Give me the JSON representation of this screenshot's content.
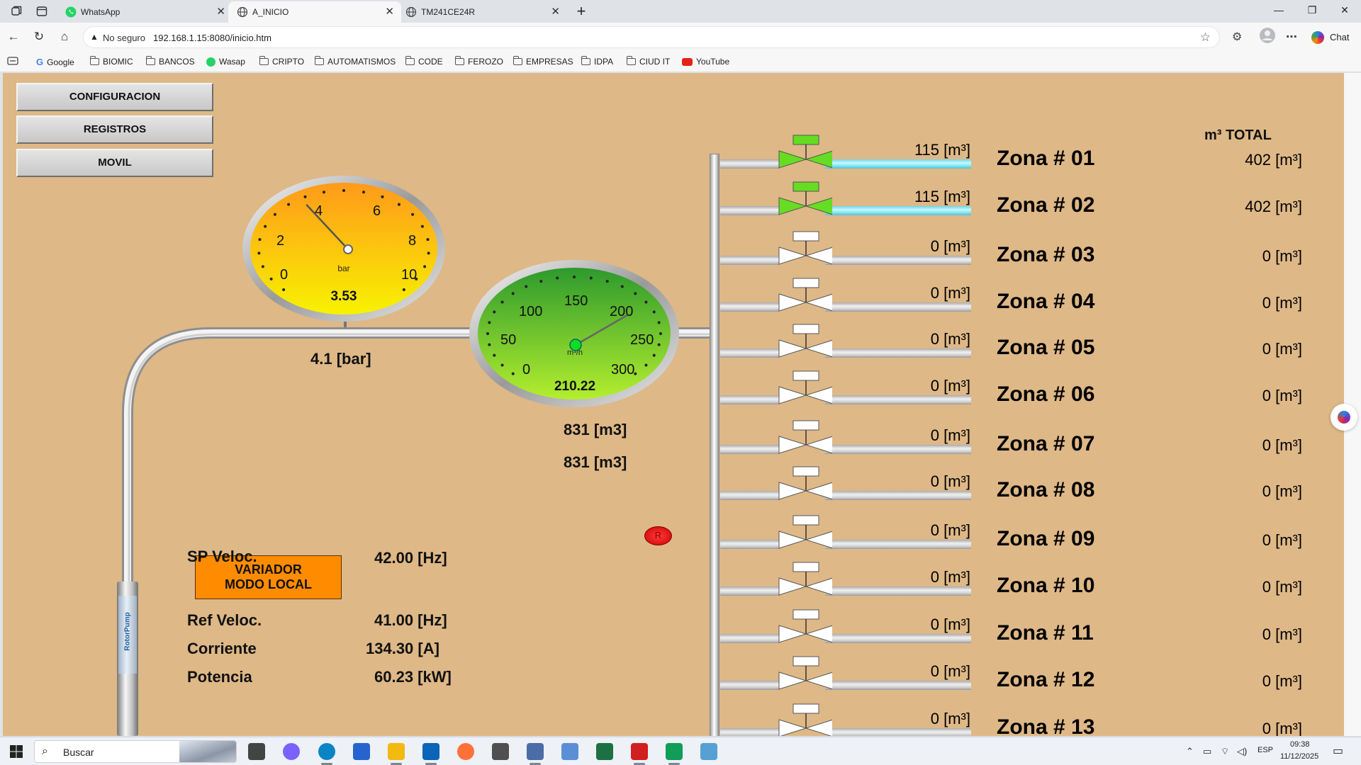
{
  "browser": {
    "tabs": [
      {
        "title": "WhatsApp",
        "active": false
      },
      {
        "title": "A_INICIO",
        "active": true
      },
      {
        "title": "TM241CE24R",
        "active": false
      }
    ],
    "security_label": "No seguro",
    "url": "192.168.1.15:8080/inicio.htm",
    "chat_label": "Chat",
    "bookmarks": [
      "Google",
      "BIOMIC",
      "BANCOS",
      "Wasap",
      "CRIPTO",
      "AUTOMATISMOS",
      "CODE",
      "FEROZO",
      "EMPRESAS",
      "IDPA",
      "CIUD IT",
      "YouTube"
    ]
  },
  "scada": {
    "menu": [
      "CONFIGURACION",
      "REGISTROS",
      "MOVIL"
    ],
    "pressure_gauge": {
      "unit": "bar",
      "value": "3.53",
      "numeric_value": 3.53,
      "min": 0,
      "max": 10,
      "ticks": [
        "0",
        "2",
        "4",
        "6",
        "8",
        "10"
      ],
      "colors": {
        "top": "#ff9a1a",
        "bottom": "#f7f200"
      }
    },
    "pressure_reading": "4.1 [bar]",
    "flow_gauge": {
      "unit": "m³/h",
      "value": "210.22",
      "numeric_value": 210.22,
      "min": 0,
      "max": 300,
      "ticks": [
        "0",
        "50",
        "100",
        "150",
        "200",
        "250",
        "300"
      ],
      "colors": {
        "top": "#2d9a2d",
        "bottom": "#b4ee2e"
      }
    },
    "volume_1": "831 [m3]",
    "volume_2": "831 [m3]",
    "reset_label": "R",
    "variador_line1": "VARIADOR",
    "variador_line2": "MODO LOCAL",
    "params": [
      {
        "label": "SP Veloc.",
        "value": "42.00 [Hz]"
      },
      {
        "label": "Ref Veloc.",
        "value": "41.00 [Hz]"
      },
      {
        "label": "Corriente",
        "value": "134.30 [A]"
      },
      {
        "label": "Potencia",
        "value": "60.23 [kW]"
      }
    ],
    "pump_brand": "RotorPump",
    "total_header": "m³ TOTAL",
    "zones": [
      {
        "name": "Zona # 01",
        "flow": "115 [m³]",
        "total": "402 [m³]",
        "active": true
      },
      {
        "name": "Zona # 02",
        "flow": "115 [m³]",
        "total": "402 [m³]",
        "active": true
      },
      {
        "name": "Zona # 03",
        "flow": "0 [m³]",
        "total": "0 [m³]",
        "active": false
      },
      {
        "name": "Zona # 04",
        "flow": "0 [m³]",
        "total": "0 [m³]",
        "active": false
      },
      {
        "name": "Zona # 05",
        "flow": "0 [m³]",
        "total": "0 [m³]",
        "active": false
      },
      {
        "name": "Zona # 06",
        "flow": "0 [m³]",
        "total": "0 [m³]",
        "active": false
      },
      {
        "name": "Zona # 07",
        "flow": "0 [m³]",
        "total": "0 [m³]",
        "active": false
      },
      {
        "name": "Zona # 08",
        "flow": "0 [m³]",
        "total": "0 [m³]",
        "active": false
      },
      {
        "name": "Zona # 09",
        "flow": "0 [m³]",
        "total": "0 [m³]",
        "active": false
      },
      {
        "name": "Zona # 10",
        "flow": "0 [m³]",
        "total": "0 [m³]",
        "active": false
      },
      {
        "name": "Zona # 11",
        "flow": "0 [m³]",
        "total": "0 [m³]",
        "active": false
      },
      {
        "name": "Zona # 12",
        "flow": "0 [m³]",
        "total": "0 [m³]",
        "active": false
      },
      {
        "name": "Zona # 13",
        "flow": "0 [m³]",
        "total": "0 [m³]",
        "active": false
      }
    ],
    "colors": {
      "background": "#deb887",
      "valve_open": "#66dd22",
      "valve_closed": "#ffffff",
      "pipe_active": "#80e6f2"
    }
  },
  "taskbar": {
    "search_placeholder": "Buscar",
    "language": "ESP",
    "time": "09:38",
    "date": "11/12/2025",
    "apps": [
      "task-view",
      "copilot",
      "edge",
      "todo",
      "file-explorer",
      "outlook",
      "firefox",
      "camera",
      "calculator",
      "snipping",
      "excel",
      "acrobat",
      "sheets",
      "paint"
    ]
  }
}
